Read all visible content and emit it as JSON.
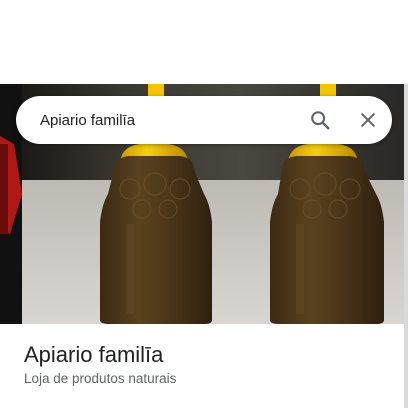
{
  "search": {
    "query": "Apiario familīa",
    "search_icon": "search-icon",
    "close_icon": "close-icon"
  },
  "place": {
    "name": "Apiario familīa",
    "category": "Loja de produtos naturais"
  },
  "photo": {
    "subject": "honey-bottles-photo",
    "cap_color": "#f2c400",
    "honey_color": "#4a3418"
  }
}
